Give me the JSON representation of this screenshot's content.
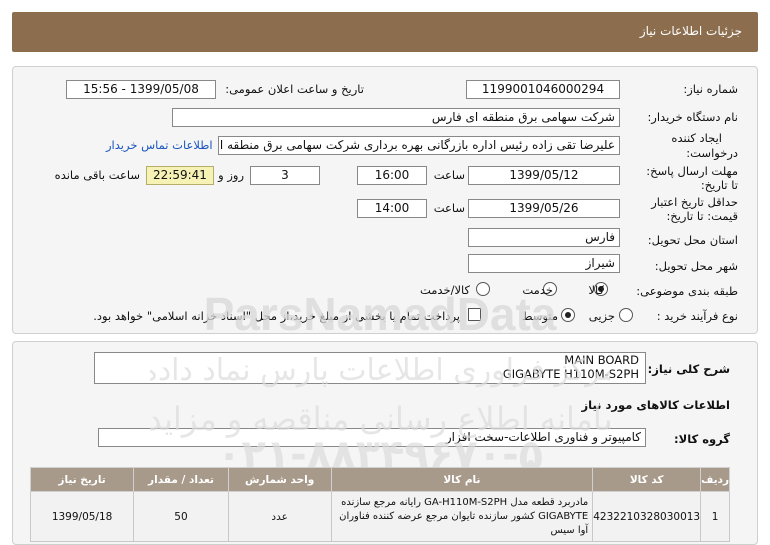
{
  "header": {
    "title": "جزئیات اطلاعات نیاز"
  },
  "form": {
    "need_number_label": "شماره نیاز:",
    "need_number": "1199001046000294",
    "announce_label": "تاریخ و ساعت اعلان عمومی:",
    "announce_value": "1399/05/08 - 15:56",
    "buyer_label": "نام دستگاه خریدار:",
    "buyer_value": "شرکت سهامی برق منطقه ای فارس",
    "creator_label_1": "ایجاد کننده",
    "creator_label_2": "درخواست:",
    "creator_value": "علیرضا  تقی زاده رئیس اداره بازرگانی بهره برداری شرکت سهامی برق منطقه ای",
    "contact_link": "اطلاعات تماس خریدار",
    "deadline_label_1": "مهلت ارسال پاسخ:",
    "deadline_label_2": "تا تاریخ:",
    "deadline_date": "1399/05/12",
    "time_label": "ساعت",
    "deadline_time": "16:00",
    "days_value": "3",
    "days_label": "روز و",
    "remaining_time": "22:59:41",
    "remaining_label": "ساعت باقی مانده",
    "validity_label_1": "حداقل تاریخ اعتبار",
    "validity_label_2": "قیمت: تا تاریخ:",
    "validity_date": "1399/05/26",
    "validity_time_label": "ساعت",
    "validity_time": "14:00",
    "province_label": "استان محل تحویل:",
    "province_value": "فارس",
    "city_label": "شهر محل تحویل:",
    "city_value": "شیراز",
    "category_label": "طبقه بندی موضوعی:",
    "category_options": [
      "کالا",
      "خدمت",
      "کالا/خدمت"
    ],
    "category_selected": "کالا",
    "process_label": "نوع فرآیند خرید :",
    "process_options": [
      "جزیی",
      "متوسط"
    ],
    "process_selected": "متوسط",
    "payment_note": "پرداخت تمام یا بخشی از مبلغ خرید،از محل \"اسناد خزانه اسلامی\" خواهد بود."
  },
  "summary": {
    "label": "شرح کلی نیاز:",
    "line1": "MAIN BOARD",
    "line2": "GIGABYTE H110M-S2PH",
    "goods_info_title": "اطلاعات کالاهای مورد نیاز",
    "group_label": "گروه کالا:",
    "group_value": "کامپیوتر و فناوری اطلاعات-سخت افزار"
  },
  "table": {
    "headers": [
      "ردیف",
      "کد کالا",
      "نام کالا",
      "واحد شمارش",
      "تعداد / مقدار",
      "تاریخ نیاز"
    ],
    "rows": [
      {
        "row": "1",
        "code": "4232210328030013",
        "name": "مادربرد قطعه مدل GA-H110M-S2PH رایانه مرجع سازنده GIGABYTE کشور سازنده تایوان مرجع عرضه کننده فناوران آوا سیس",
        "unit": "عدد",
        "qty": "50",
        "date": "1399/05/18"
      }
    ]
  },
  "colors": {
    "header_bg": "#8c6e4f",
    "link": "#1a55c0",
    "timer_bg": "#f6f1b4",
    "table_header_bg": "#a89a8a"
  }
}
